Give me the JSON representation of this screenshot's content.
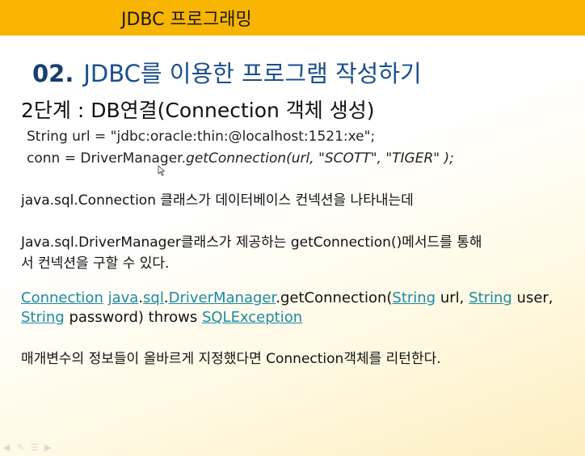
{
  "header": {
    "title": "JDBC 프로그래밍"
  },
  "slide": {
    "number": "02.",
    "title": "JDBC를 이용한 프로그램 작성하기",
    "step": "2단계 : DB연결(Connection 객체 생성)"
  },
  "code": {
    "line1": "String url = \"jdbc:oracle:thin:@localhost:1521:xe\";",
    "line2_prefix": "conn = DriverManager.",
    "line2_italic": "getConnection(url, \"SCOTT\", \"TIGER\" );"
  },
  "text": {
    "p1": "java.sql.Connection 클래스가 데이터베이스 컨넥션을 나타내는데",
    "p2a": "Java.sql.DriverManager클래스가 제공하는 getConnection()메서드를 통해",
    "p2b": "서 컨넥션을 구할 수 있다.",
    "p4": "매개변수의 정보들이 올바르게 지정했다면 Connection객체를 리턴한다."
  },
  "signature": {
    "return_type": "Connection",
    "pkg_java": "java",
    "dot1": ".",
    "pkg_sql": "sql",
    "dot2": ".",
    "class_name": "DriverManager",
    "method": ".getConnection(",
    "string1": "String",
    "url_param": " url, ",
    "string2": "String",
    "user_param": " user,",
    "string3": "String",
    "password_param": " password) throws ",
    "exception": "SQLException"
  },
  "nav_icons": [
    "prev-arrow-icon",
    "pen-icon",
    "menu-icon",
    "next-arrow-icon"
  ]
}
